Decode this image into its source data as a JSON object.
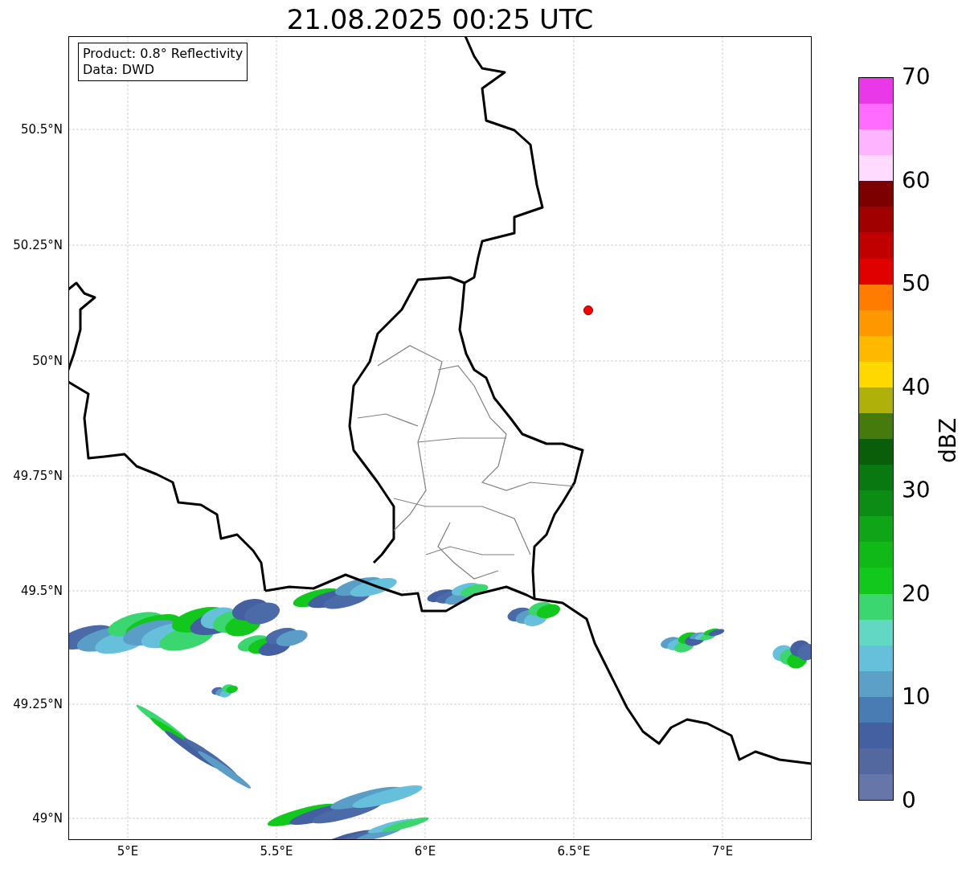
{
  "title": "21.08.2025 00:25 UTC",
  "info_box": [
    "Product: 0.8° Reflectivity",
    "Data: DWD"
  ],
  "map": {
    "y_ticks": [
      "50.5°N",
      "50.25°N",
      "50°N",
      "49.75°N",
      "49.5°N",
      "49.25°N",
      "49°N"
    ],
    "x_ticks": [
      "5°E",
      "5.5°E",
      "6°E",
      "6.5°E",
      "7°E"
    ]
  },
  "colorbar": {
    "label": "dBZ",
    "ticks": [
      "70",
      "60",
      "50",
      "40",
      "30",
      "20",
      "10",
      "0"
    ],
    "bands": [
      {
        "color": "#e838e8"
      },
      {
        "color": "#ff6cff"
      },
      {
        "color": "#ffb4ff"
      },
      {
        "color": "#ffdcff"
      },
      {
        "color": "#7c0000"
      },
      {
        "color": "#a00000"
      },
      {
        "color": "#c00000"
      },
      {
        "color": "#e00000"
      },
      {
        "color": "#ff7c00"
      },
      {
        "color": "#ff9800"
      },
      {
        "color": "#ffb800"
      },
      {
        "color": "#ffd800"
      },
      {
        "color": "#b0b00a"
      },
      {
        "color": "#467a0c"
      },
      {
        "color": "#0a5e0a"
      },
      {
        "color": "#0a7810"
      },
      {
        "color": "#0c8c14"
      },
      {
        "color": "#10a418"
      },
      {
        "color": "#10b818"
      },
      {
        "color": "#12c81c"
      },
      {
        "color": "#3cd670"
      },
      {
        "color": "#62d8c4"
      },
      {
        "color": "#66c0dc"
      },
      {
        "color": "#5ca0c8"
      },
      {
        "color": "#4a7cb4"
      },
      {
        "color": "#4460a0"
      },
      {
        "color": "#5468a0"
      },
      {
        "color": "#6676a8"
      }
    ]
  }
}
